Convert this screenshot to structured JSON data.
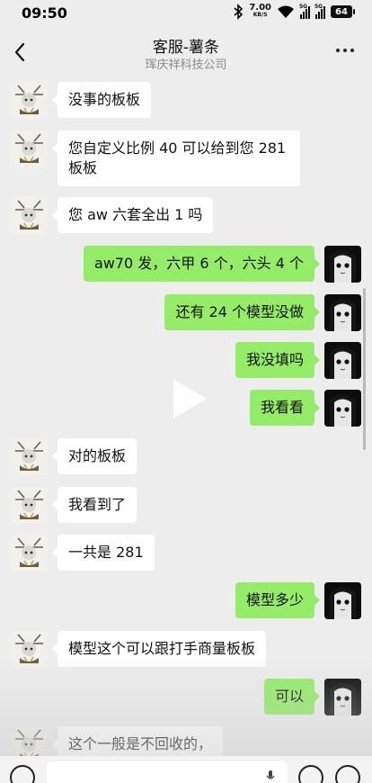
{
  "status_bar": {
    "time": "09:50",
    "net_speed_value": "7.00",
    "net_speed_unit": "KB/S",
    "signal_1_label": "5G",
    "signal_2_label": "5G",
    "battery": "64",
    "icons": [
      "bluetooth-icon",
      "wifi-icon",
      "signal-icon",
      "battery-icon"
    ]
  },
  "header": {
    "title": "客服-薯条",
    "subtitle": "珲庆祥科技公司",
    "icons": [
      "back-icon",
      "more-icon"
    ]
  },
  "messages": [
    {
      "side": "left",
      "sender": "shop",
      "text": "没事的板板"
    },
    {
      "side": "left",
      "sender": "shop",
      "text": "您自定义比例 40 可以给到您 281 板板"
    },
    {
      "side": "left",
      "sender": "shop",
      "text": "您 aw 六套全出 1 吗"
    },
    {
      "side": "right",
      "sender": "me",
      "text": "aw70 发，六甲 6 个，六头 4 个"
    },
    {
      "side": "right",
      "sender": "me",
      "text": "还有 24 个模型没做"
    },
    {
      "side": "right",
      "sender": "me",
      "text": "我没填吗"
    },
    {
      "side": "right",
      "sender": "me",
      "text": "我看看"
    },
    {
      "side": "left",
      "sender": "shop",
      "text": "对的板板"
    },
    {
      "side": "left",
      "sender": "shop",
      "text": "我看到了"
    },
    {
      "side": "left",
      "sender": "shop",
      "text": "一共是 281"
    },
    {
      "side": "right",
      "sender": "me",
      "text": "模型多少"
    },
    {
      "side": "left",
      "sender": "shop",
      "text": "模型这个可以跟打手商量板板"
    },
    {
      "side": "right",
      "sender": "me",
      "text": "可以"
    },
    {
      "side": "left",
      "sender": "shop",
      "text": "这个一般是不回收的，"
    }
  ],
  "input_bar": {
    "icons": [
      "voice-icon",
      "mic-icon",
      "emoji-icon",
      "plus-icon"
    ]
  },
  "colors": {
    "background": "#ededed",
    "outgoing_bubble": "#95ec69",
    "incoming_bubble": "#ffffff"
  }
}
